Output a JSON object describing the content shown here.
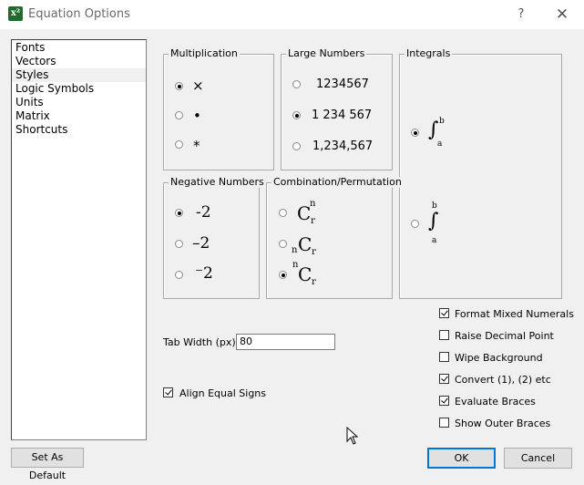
{
  "window": {
    "title": "Equation Options",
    "help": "?",
    "close": "✕",
    "icon_text": "x²"
  },
  "sidebar": {
    "items": [
      "Fonts",
      "Vectors",
      "Styles",
      "Logic Symbols",
      "Units",
      "Matrix",
      "Shortcuts"
    ],
    "selected": "Styles"
  },
  "multiplication": {
    "label": "Multiplication",
    "options": [
      "×",
      "•",
      "*"
    ],
    "selected": 0
  },
  "large_numbers": {
    "label": "Large Numbers",
    "options": [
      "1234567",
      "1 234 567",
      "1,234,567"
    ],
    "selected": 1
  },
  "integrals": {
    "label": "Integrals",
    "symbol": "∫",
    "upper": "b",
    "lower": "a",
    "selected": 0
  },
  "negative_numbers": {
    "label": "Negative Numbers",
    "options": [
      "-2",
      "–2",
      "⁻2"
    ],
    "selected": 0
  },
  "combination": {
    "label": "Combination/Permutation",
    "base": "C",
    "upper": "n",
    "lower": "r",
    "selected": 2
  },
  "tab_width": {
    "label": "Tab Width (px)",
    "value": "80"
  },
  "align_equal": {
    "label": "Align Equal Signs",
    "checked": true
  },
  "checks": [
    {
      "label": "Format Mixed Numerals",
      "checked": true
    },
    {
      "label": "Raise Decimal Point",
      "checked": false
    },
    {
      "label": "Wipe Background",
      "checked": false
    },
    {
      "label": "Convert (1), (2) etc",
      "checked": true
    },
    {
      "label": "Evaluate Braces",
      "checked": true
    },
    {
      "label": "Show Outer Braces",
      "checked": false
    }
  ],
  "buttons": {
    "set_default": "Set As Default",
    "ok": "OK",
    "cancel": "Cancel"
  },
  "colors": {
    "accent": "#0078d7",
    "window_bg": "#f0f0f0",
    "icon_bg": "#1f6b2e"
  }
}
